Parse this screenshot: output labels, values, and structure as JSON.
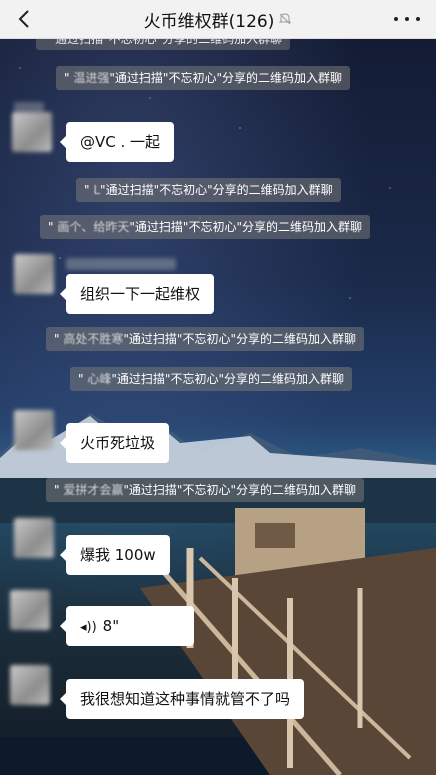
{
  "header": {
    "title": "火币维权群(126)"
  },
  "notices": [
    {
      "name": "温进强",
      "action": "通过扫描",
      "inviter": "不忘初心",
      "suffix": "分享的二维码加入群聊"
    },
    {
      "name": "",
      "action": "通过扫描",
      "inviter": "不忘初心",
      "suffix": "分享的二维码加入群聊"
    },
    {
      "name": "画个、给昨天",
      "action": "通过扫描",
      "inviter": "不忘初心",
      "suffix": "分享的二维码加入群聊"
    },
    {
      "name": "高处不胜寒",
      "action": "通过扫描",
      "inviter": "不忘初心",
      "suffix": "分享的二维码加入群聊"
    },
    {
      "name": "心峰",
      "action": "通过扫描",
      "inviter": "不忘初心",
      "suffix": "分享的二维码加入群聊"
    },
    {
      "name": "爱拼才会赢",
      "action": "通过扫描",
      "inviter": "不忘初心",
      "suffix": "分享的二维码加入群聊"
    }
  ],
  "messages": [
    {
      "text": "@VC               .  一起"
    },
    {
      "text": "组织一下一起维权"
    },
    {
      "text": "火币死垃圾"
    },
    {
      "text": "爆我 100w"
    },
    {
      "voice_duration": "8\""
    },
    {
      "text": "我很想知道这种事情就管不了吗"
    }
  ],
  "colors": {
    "header_bg": "#f2f2f2",
    "bubble_bg": "#ffffff",
    "notice_bg": "rgba(120,120,120,0.55)"
  }
}
